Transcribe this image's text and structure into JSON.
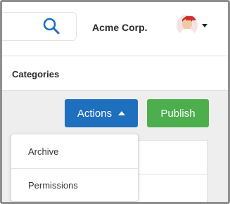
{
  "header": {
    "company_name": "Acme Corp."
  },
  "nav": {
    "categories_label": "Categories"
  },
  "toolbar": {
    "actions_label": "Actions",
    "publish_label": "Publish"
  },
  "actions_menu": {
    "items": [
      {
        "label": "Archive"
      },
      {
        "label": "Permissions"
      }
    ]
  },
  "colors": {
    "accent_blue": "#1f6fbf",
    "publish_green": "#4cae4c",
    "search_icon": "#1f6fbf"
  },
  "icons": {
    "search": "search-icon",
    "avatar": "acme-avatar",
    "menu_caret": "caret-down-icon",
    "actions_caret": "caret-up-icon"
  }
}
